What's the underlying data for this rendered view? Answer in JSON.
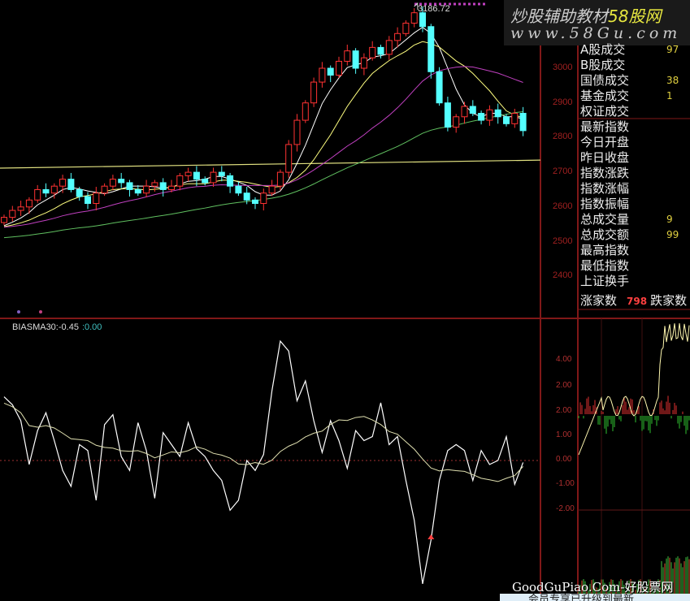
{
  "banner": {
    "title_cn": "炒股辅助教材",
    "title_brand": "58股网",
    "url": "www.58Gu.com"
  },
  "peak_label": "3186.72",
  "info_panel": {
    "rows": [
      {
        "label": "A股成交",
        "value": "97"
      },
      {
        "label": "B股成交",
        "value": ""
      },
      {
        "label": "国债成交",
        "value": "38"
      },
      {
        "label": "基金成交",
        "value": "1"
      },
      {
        "label": "权证成交",
        "value": ""
      },
      {
        "label": "最新指数",
        "value": ""
      },
      {
        "label": "今日开盘",
        "value": ""
      },
      {
        "label": "昨日收盘",
        "value": ""
      },
      {
        "label": "指数涨跌",
        "value": ""
      },
      {
        "label": "指数涨幅",
        "value": ""
      },
      {
        "label": "指数振幅",
        "value": ""
      },
      {
        "label": "总成交量",
        "value": "9"
      },
      {
        "label": "总成交额",
        "value": "99"
      },
      {
        "label": "最高指数",
        "value": ""
      },
      {
        "label": "最低指数",
        "value": ""
      },
      {
        "label": "上证换手",
        "value": ""
      }
    ],
    "up_label": "涨家数",
    "up_count": "798",
    "down_label": "跌家数"
  },
  "indicator": {
    "name": "BIASMA30:-0.45",
    "value2": ":0.00"
  },
  "watermark": "GoodGuPiao.Com-好股票网",
  "bottom_bar": "会员专享已升级到最新",
  "colors": {
    "up": "#ff3232",
    "down": "#54ffff",
    "ma5": "#ffffff",
    "ma10": "#ffff80",
    "ma20": "#c040c0",
    "ma60": "#60c060",
    "axis": "#a02020"
  },
  "chart_data": [
    {
      "type": "candlestick",
      "title": "",
      "y_ticks": [
        "3000",
        "2900",
        "2800",
        "2700",
        "2600",
        "2500",
        "2400"
      ],
      "ylim": [
        2400,
        3190
      ],
      "open": [
        2555,
        2570,
        2590,
        2600,
        2620,
        2650,
        2640,
        2660,
        2680,
        2650,
        2630,
        2610,
        2640,
        2660,
        2680,
        2670,
        2650,
        2640,
        2660,
        2670,
        2650,
        2660,
        2690,
        2700,
        2680,
        2670,
        2700,
        2690,
        2660,
        2640,
        2620,
        2610,
        2640,
        2660,
        2700,
        2780,
        2850,
        2900,
        2960,
        3000,
        2980,
        3020,
        3050,
        3000,
        3030,
        3060,
        3040,
        3080,
        3100,
        3130,
        3160,
        3120,
        2990,
        2900,
        2830,
        2860,
        2890,
        2870,
        2850,
        2880,
        2860,
        2840,
        2870
      ],
      "close": [
        2570,
        2590,
        2600,
        2620,
        2650,
        2640,
        2660,
        2680,
        2650,
        2630,
        2610,
        2640,
        2660,
        2680,
        2670,
        2650,
        2640,
        2660,
        2670,
        2650,
        2660,
        2690,
        2700,
        2680,
        2670,
        2700,
        2690,
        2660,
        2640,
        2620,
        2610,
        2640,
        2660,
        2700,
        2780,
        2850,
        2900,
        2960,
        3000,
        2980,
        3020,
        3050,
        3000,
        3030,
        3060,
        3040,
        3080,
        3100,
        3130,
        3160,
        3120,
        2990,
        2900,
        2830,
        2860,
        2890,
        2870,
        2850,
        2880,
        2860,
        2840,
        2870,
        2820
      ],
      "reference_line": [
        2712,
        2735
      ],
      "peak": 3186.72
    },
    {
      "type": "line",
      "title": "BIASMA30",
      "series": [
        {
          "name": "BIAS",
          "values": [
            3.2,
            2.8,
            2.0,
            -0.2,
            1.5,
            2.4,
            1.0,
            -0.5,
            -1.3,
            0.8,
            0.5,
            -2.0,
            1.8,
            2.3,
            0.2,
            -0.5,
            1.9,
            0.5,
            -1.9,
            1.4,
            0.8,
            0.2,
            1.9,
            0.6,
            0.2,
            -0.5,
            -1.0,
            -2.5,
            -2.0,
            0.0,
            -0.5,
            0.3,
            3.5,
            6.0,
            5.5,
            3.0,
            4.0,
            2.0,
            0.4,
            2.0,
            1.0,
            -0.4,
            1.5,
            1.0,
            1.2,
            2.9,
            0.8,
            1.2,
            -1.0,
            -3.0,
            -6.2,
            -4.0,
            -1.0,
            0.5,
            0.8,
            0.5,
            -1.0,
            0.5,
            -0.2,
            0.0,
            1.2,
            -1.2,
            -0.1
          ]
        }
      ],
      "ylim": [
        -6.5,
        6.5
      ]
    },
    {
      "type": "line",
      "title": "intraday",
      "y_ticks": [
        "4.00",
        "2.00",
        "2.00",
        "1.00",
        "0.00",
        "-1.00",
        "-2.00"
      ]
    }
  ]
}
